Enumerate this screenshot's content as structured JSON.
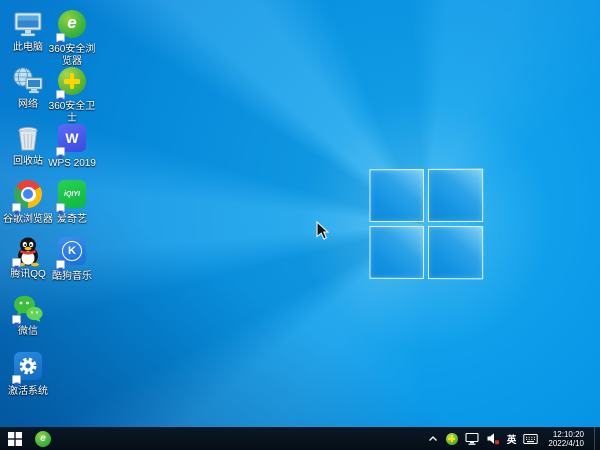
{
  "wallpaper": {
    "base_color": "#0795e6",
    "logo": "windows-10-hero"
  },
  "desktop": {
    "icons": [
      {
        "id": "this-pc",
        "label": "此电脑",
        "shortcut": false
      },
      {
        "id": "360-browser",
        "label": "360安全浏览器",
        "shortcut": true,
        "glyph": "e"
      },
      {
        "id": "network",
        "label": "网络",
        "shortcut": false
      },
      {
        "id": "360-safe",
        "label": "360安全卫士",
        "shortcut": true
      },
      {
        "id": "recycle-bin",
        "label": "回收站",
        "shortcut": false
      },
      {
        "id": "wps-2019",
        "label": "WPS 2019",
        "shortcut": true,
        "glyph": "W"
      },
      {
        "id": "chrome",
        "label": "谷歌浏览器",
        "shortcut": true
      },
      {
        "id": "iqiyi",
        "label": "爱奇艺",
        "shortcut": true,
        "glyph": "iQIYI"
      },
      {
        "id": "tencent-qq",
        "label": "腾讯QQ",
        "shortcut": true
      },
      {
        "id": "kugou",
        "label": "酷狗音乐",
        "shortcut": true,
        "glyph": "K"
      },
      {
        "id": "wechat",
        "label": "微信",
        "shortcut": true
      },
      {
        "id": "activate",
        "label": "激活系统",
        "shortcut": true
      }
    ]
  },
  "taskbar": {
    "pinned": [
      {
        "id": "360-browser-task",
        "glyph": "e"
      }
    ],
    "tray": {
      "input_indicator": "英",
      "clock": {
        "time": "12:10:20",
        "date": "2022/4/10"
      }
    },
    "colors": {
      "background": "#081421",
      "accent": "#0795e6"
    }
  }
}
